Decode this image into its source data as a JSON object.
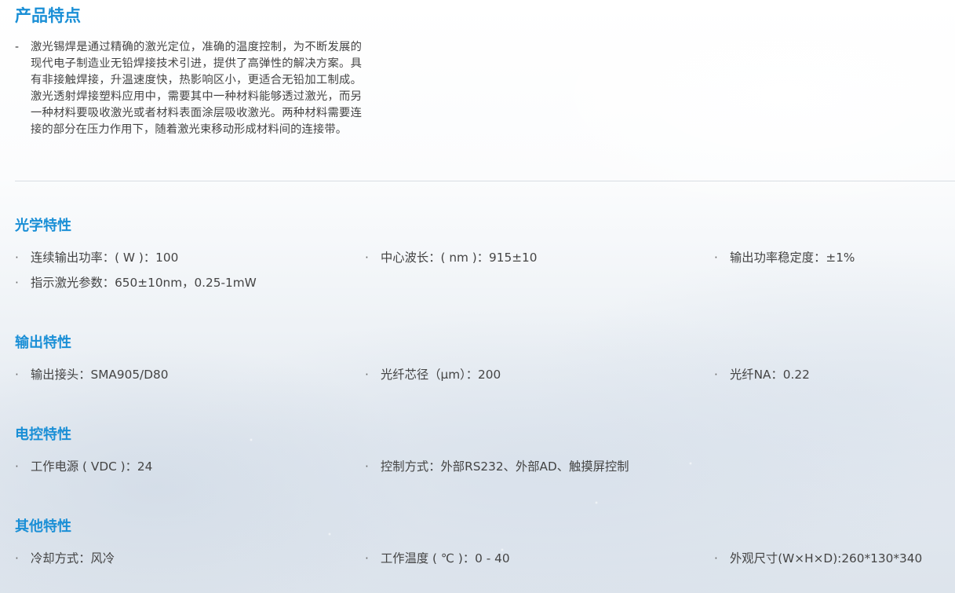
{
  "product": {
    "title": "产品特点",
    "bullet": "-",
    "description": "激光锡焊是通过精确的激光定位，准确的温度控制，为不断发展的现代电子制造业无铅焊接技术引进，提供了高弹性的解决方案。具有非接触焊接，升温速度快，热影响区小，更适合无铅加工制成。激光透射焊接塑料应用中，需要其中一种材料能够透过激光，而另一种材料要吸收激光或者材料表面涂层吸收激光。两种材料需要连接的部分在压力作用下，随着激光束移动形成材料间的连接带。"
  },
  "bullet_glyph": "·",
  "optical": {
    "title": "光学特性",
    "items": [
      "连续输出功率：( W )：100",
      "中心波长：( nm )：915±10",
      "输出功率稳定度：±1%",
      "指示激光参数：650±10nm，0.25-1mW"
    ]
  },
  "output": {
    "title": "输出特性",
    "items": [
      "输出接头：SMA905/D80",
      "光纤芯径（μm）：200",
      "光纤NA：0.22"
    ]
  },
  "electric": {
    "title": "电控特性",
    "items": [
      "工作电源 ( VDC )：24",
      "控制方式：外部RS232、外部AD、触摸屏控制"
    ]
  },
  "other": {
    "title": "其他特性",
    "items": [
      "冷却方式：风冷",
      "工作温度 ( ℃ )：0 - 40",
      "外观尺寸(W×H×D):260*130*340"
    ]
  }
}
